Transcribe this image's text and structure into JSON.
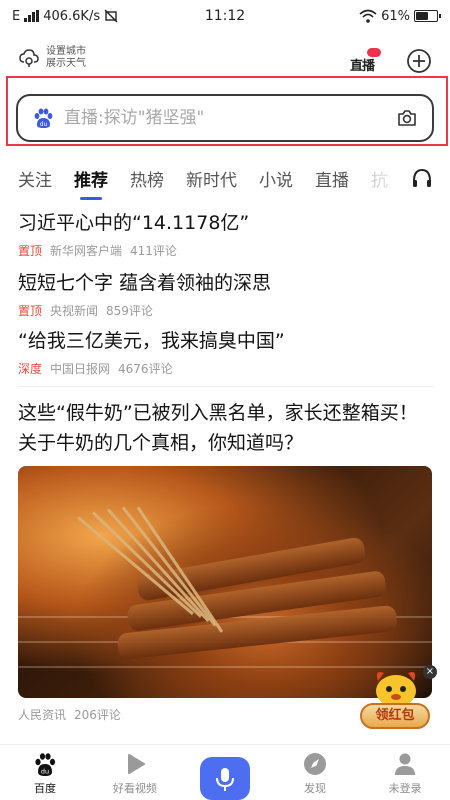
{
  "status_bar": {
    "network": "E",
    "speed": "406.6K/s",
    "time": "11:12",
    "battery": "61%",
    "battery_level": 0.61
  },
  "header": {
    "weather_line1": "设置城市",
    "weather_line2": "展示天气",
    "live_label": "直播"
  },
  "search": {
    "placeholder": "直播:探访\"猪坚强\""
  },
  "tabs": [
    "关注",
    "推荐",
    "热榜",
    "新时代",
    "小说",
    "直播",
    "抗"
  ],
  "news": [
    {
      "title": "习近平心中的“14.1178亿”",
      "tag": "置顶",
      "source": "新华网客户端",
      "comments": "411评论"
    },
    {
      "title": "短短七个字 蕴含着领袖的深思",
      "tag": "置顶",
      "source": "央视新闻",
      "comments": "859评论"
    },
    {
      "title": "“给我三亿美元，我来搞臭中国”",
      "tag": "深度",
      "source": "中国日报网",
      "comments": "4676评论"
    }
  ],
  "article": {
    "title": "这些“假牛奶”已被列入黑名单，家长还整箱买！关于牛奶的几个真相，你知道吗？",
    "source": "人民资讯",
    "comments": "206评论"
  },
  "promo": {
    "label": "领红包",
    "close": "×"
  },
  "bottom_nav": {
    "home": "百度",
    "video": "好看视频",
    "discover": "发现",
    "login": "未登录"
  },
  "colors": {
    "accent": "#4e6ef2",
    "highlight": "#e8394d",
    "tag": "#e94a3a"
  }
}
